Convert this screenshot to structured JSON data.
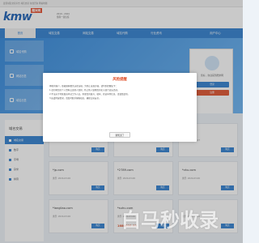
{
  "topbar": {
    "text": "最佳域名交易平台 域名交易 在线咨询 网站地图"
  },
  "header": {
    "logo_text": "kmw",
    "logo_badge": "酷米网",
    "slogan_line1": "2019 - 2024",
    "slogan_line2": "值得一直信任"
  },
  "nav": {
    "items": [
      "首页",
      "域名交易",
      "网站交易",
      "域名代购",
      "行业资讯",
      "",
      "用户中心"
    ]
  },
  "sidebar": {
    "items": [
      "域名代购",
      "网站出售",
      "域名出售"
    ]
  },
  "right_panel": {
    "hello": "您好，欢迎来到酷米网",
    "login": "登录",
    "register": "注册"
  },
  "modal": {
    "title": "风险提醒",
    "para1": "尊敬的客户，依据国家相关法律法规，为防止出现诈骗，请特别提醒如下：",
    "para2": "1.请勿将您的个人资料交由他人保管，防止他人冒用您的名义进行违法活动。",
    "para3": "2.不法分子可能冒充本站工作人员，索要您的账号、密码、验证码等信息，请谨慎识别。",
    "para4": "3.如遇可疑情况，请及时联系客服核实，确保交易安全。",
    "button": "我知道了"
  },
  "left_menu": {
    "title": "域名交易",
    "items": [
      "域名交易",
      "数字",
      "字母",
      "杂米",
      "拼音"
    ]
  },
  "cards": [
    {
      "domain": "",
      "type": "类型:",
      "date": "2024-03-07",
      "price": "",
      "buy": "购买"
    },
    {
      "domain": "",
      "type": "类型:",
      "date": "2024-03-07",
      "price": "",
      "buy": "购买"
    },
    {
      "domain": "",
      "type": "类型:",
      "date": "2024-03-07",
      "price": "",
      "buy": "购买"
    },
    {
      "domain": "*jp.com",
      "type": "类型:",
      "date": "2024-03-06",
      "price": "",
      "buy": "购买"
    },
    {
      "domain": "*2789.com",
      "type": "类型:",
      "date": "2024-03-06",
      "price": "",
      "buy": "购买"
    },
    {
      "domain": "*vku.com",
      "type": "类型:",
      "date": "2024-03-06",
      "price": "",
      "buy": "购买"
    },
    {
      "domain": "*langliao.com",
      "type": "类型:",
      "date": "2024-03-06",
      "price": "",
      "buy": "购买"
    },
    {
      "domain": "*suhu.com",
      "type": "类型:",
      "date": "2024-03-06",
      "price": "1680000.00",
      "buy": "购买"
    },
    {
      "domain": "",
      "type": "类型:",
      "date": "2024-03-06",
      "price": "",
      "buy": "购买"
    }
  ],
  "watermark": "白马秒收录"
}
